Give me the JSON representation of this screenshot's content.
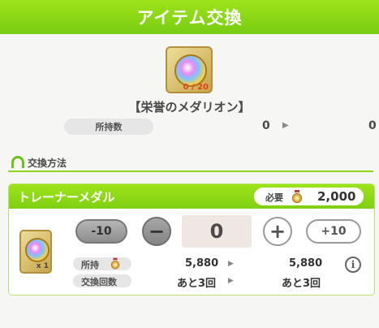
{
  "header": {
    "title": "アイテム交換"
  },
  "item": {
    "name": "【栄誉のメダリオン】",
    "icon": "medallion-icon",
    "count": "0 / 20",
    "owned_label": "所持数",
    "owned_before": "0",
    "owned_after": "0"
  },
  "section": {
    "title": "交換方法",
    "icon": "horseshoe-icon"
  },
  "exchange": {
    "title": "トレーナーメダル",
    "cost_label": "必要",
    "cost_value": "2,000",
    "cost_icon": "medal-bag-icon",
    "thumb_qty": "x 1",
    "buttons": {
      "minus10": "-10",
      "minus": "−",
      "plus": "+",
      "plus10": "+10"
    },
    "quantity": "0",
    "held_label": "所持",
    "held_before": "5,880",
    "held_after": "5,880",
    "times_label": "交換回数",
    "times_before": "あと3回",
    "times_after": "あと3回",
    "info_icon": "i"
  },
  "colors": {
    "accent": "#8dd71a",
    "counter": "#e3401c"
  }
}
